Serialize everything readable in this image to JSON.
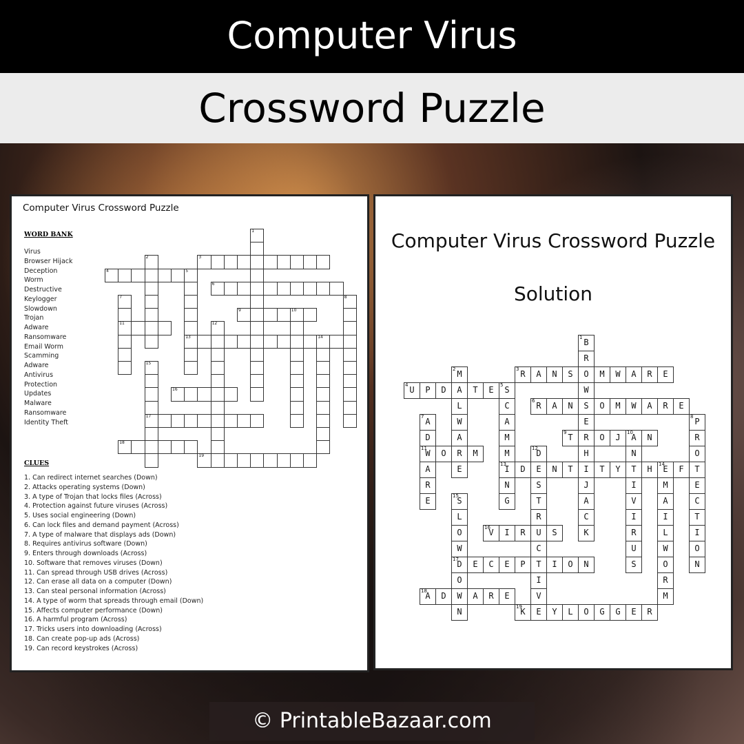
{
  "header": {
    "title": "Computer Virus",
    "subtitle": "Crossword Puzzle"
  },
  "puzzle": {
    "title": "Computer Virus Crossword Puzzle",
    "word_bank_label": "WORD BANK",
    "word_bank": [
      "Virus",
      "Browser Hijack",
      "Deception",
      "Worm",
      "Destructive",
      "Keylogger",
      "Slowdown",
      "Trojan",
      "Adware",
      "Ransomware",
      "Email Worm",
      "Scamming",
      "Adware",
      "Antivirus",
      "Protection",
      "Updates",
      "Malware",
      "Ransomware",
      "Identity Theft"
    ],
    "clues_label": "CLUES",
    "clues": [
      "1. Can redirect internet searches (Down)",
      "2. Attacks operating systems (Down)",
      "3. A type of Trojan that locks files (Across)",
      "4. Protection against future viruses (Across)",
      "5. Uses social engineering (Down)",
      "6. Can lock files and demand payment (Across)",
      "7. A type of malware that displays ads (Down)",
      "8. Requires antivirus software (Down)",
      "9. Enters through downloads (Across)",
      "10. Software that removes viruses (Down)",
      "11. Can spread through USB drives (Across)",
      "12. Can erase all data on a computer (Down)",
      "13. Can steal personal information (Across)",
      "14. A type of worm that spreads through email (Down)",
      "15. Affects computer performance (Down)",
      "16. A harmful program (Across)",
      "17. Tricks users into downloading (Across)",
      "18. Can create pop-up ads (Across)",
      "19. Can record keystrokes (Across)"
    ]
  },
  "solution": {
    "title": "Computer Virus Crossword Puzzle",
    "label": "Solution",
    "words": [
      {
        "n": 1,
        "r": 0,
        "c": 11,
        "d": "down",
        "a": "BROWSERHIJACK"
      },
      {
        "n": 2,
        "r": 2,
        "c": 3,
        "d": "down",
        "a": "MALWARE"
      },
      {
        "n": 3,
        "r": 2,
        "c": 7,
        "d": "across",
        "a": "RANSOMWARE"
      },
      {
        "n": 4,
        "r": 3,
        "c": 0,
        "d": "across",
        "a": "UPDATES"
      },
      {
        "n": 5,
        "r": 3,
        "c": 6,
        "d": "down",
        "a": "SCAMMING"
      },
      {
        "n": 6,
        "r": 4,
        "c": 8,
        "d": "across",
        "a": "RANSOMWARE"
      },
      {
        "n": 7,
        "r": 5,
        "c": 1,
        "d": "down",
        "a": "ADWARE"
      },
      {
        "n": 8,
        "r": 5,
        "c": 18,
        "d": "down",
        "a": "PROTECTION"
      },
      {
        "n": 9,
        "r": 6,
        "c": 10,
        "d": "across",
        "a": "TROJAN"
      },
      {
        "n": 10,
        "r": 6,
        "c": 14,
        "d": "down",
        "a": "ANTIVIRUS"
      },
      {
        "n": 11,
        "r": 7,
        "c": 1,
        "d": "across",
        "a": "WORM"
      },
      {
        "n": 12,
        "r": 7,
        "c": 8,
        "d": "down",
        "a": "DESTRUCTIVE"
      },
      {
        "n": 13,
        "r": 8,
        "c": 6,
        "d": "across",
        "a": "IDENTITYTHEFT"
      },
      {
        "n": 14,
        "r": 8,
        "c": 16,
        "d": "down",
        "a": "EMAILWORM"
      },
      {
        "n": 15,
        "r": 10,
        "c": 3,
        "d": "down",
        "a": "SLOWDOWN"
      },
      {
        "n": 16,
        "r": 12,
        "c": 5,
        "d": "across",
        "a": "VIRUS"
      },
      {
        "n": 17,
        "r": 14,
        "c": 3,
        "d": "across",
        "a": "DECEPTION"
      },
      {
        "n": 18,
        "r": 16,
        "c": 1,
        "d": "across",
        "a": "ADWARE"
      },
      {
        "n": 19,
        "r": 17,
        "c": 7,
        "d": "across",
        "a": "KEYLOGGER"
      }
    ]
  },
  "footer": {
    "copyright": "© PrintableBazaar.com"
  }
}
